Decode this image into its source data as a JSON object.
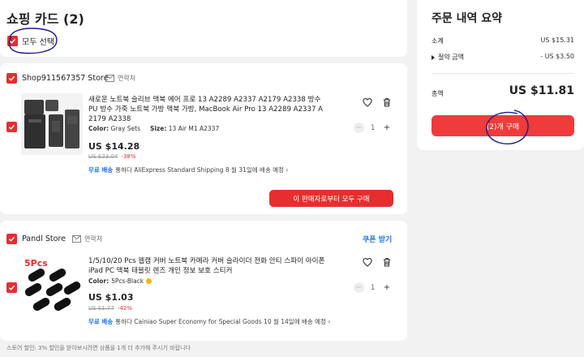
{
  "cart": {
    "title": "쇼핑 카드 (2)",
    "select_all": "모두 선택"
  },
  "stores": [
    {
      "name": "Shop911567357 Store",
      "contact": "연락처",
      "item": {
        "title": "새로운 노트북 슬리브 맥북 에어 프로 13 A2289 A2337 A2179 A2338 방수 PU 방수 가죽 노트북 가방 맥북 가방, MacBook Air Pro 13 A2289 A2337 A 2179 A2338",
        "color_label": "Color:",
        "color_value": "Gray Sets",
        "size_label": "Size:",
        "size_value": "13 Air M1 A2337",
        "price": "US $14.28",
        "orig_price": "US $23.04",
        "discount": "-38%",
        "ship_free": "무료 배송",
        "ship_text": "통하다 AliExpress Standard Shipping 8 월 31일에 배송 예정",
        "qty": "1"
      },
      "buy_label": "이 판매자로부터 모두 구매"
    },
    {
      "name": "Pandl Store",
      "contact": "연락처",
      "coupon": "쿠폰 받기",
      "item": {
        "title": "1/5/10/20 Pcs 웹캠 커버 노트북 카메라 커버 슬라이더 전화 안티 스파이 아이폰 iPad PC 맥북 태블릿 렌즈 개인 정보 보호 스티커",
        "color_label": "Color:",
        "color_value": "5Pcs-Black",
        "thumb_text": "5Pcs",
        "price": "US $1.03",
        "orig_price": "US $1.77",
        "discount": "-42%",
        "ship_free": "무료 배송",
        "ship_text": "통하다 Cainiao Super Economy for Special Goods 10 월 14일에 배송 예정",
        "qty": "1"
      }
    }
  ],
  "footer_note": "스토어 할인: 3% 할인을 받아보시려면 상품을 1개 더 추가해 주시기 바랍니다",
  "summary": {
    "title": "주문 내역 요약",
    "subtotal_label": "소계",
    "subtotal_value": "US $15.31",
    "savings_label": "절약 금액",
    "savings_value": "- US $3.50",
    "total_label": "총액",
    "total_value": "US $11.81",
    "checkout_label": "(2)개 구매"
  },
  "colors": {
    "accent_red": "#e62e2e",
    "link_blue": "#1a73e8",
    "annotation_ink": "#1c1c8c"
  }
}
